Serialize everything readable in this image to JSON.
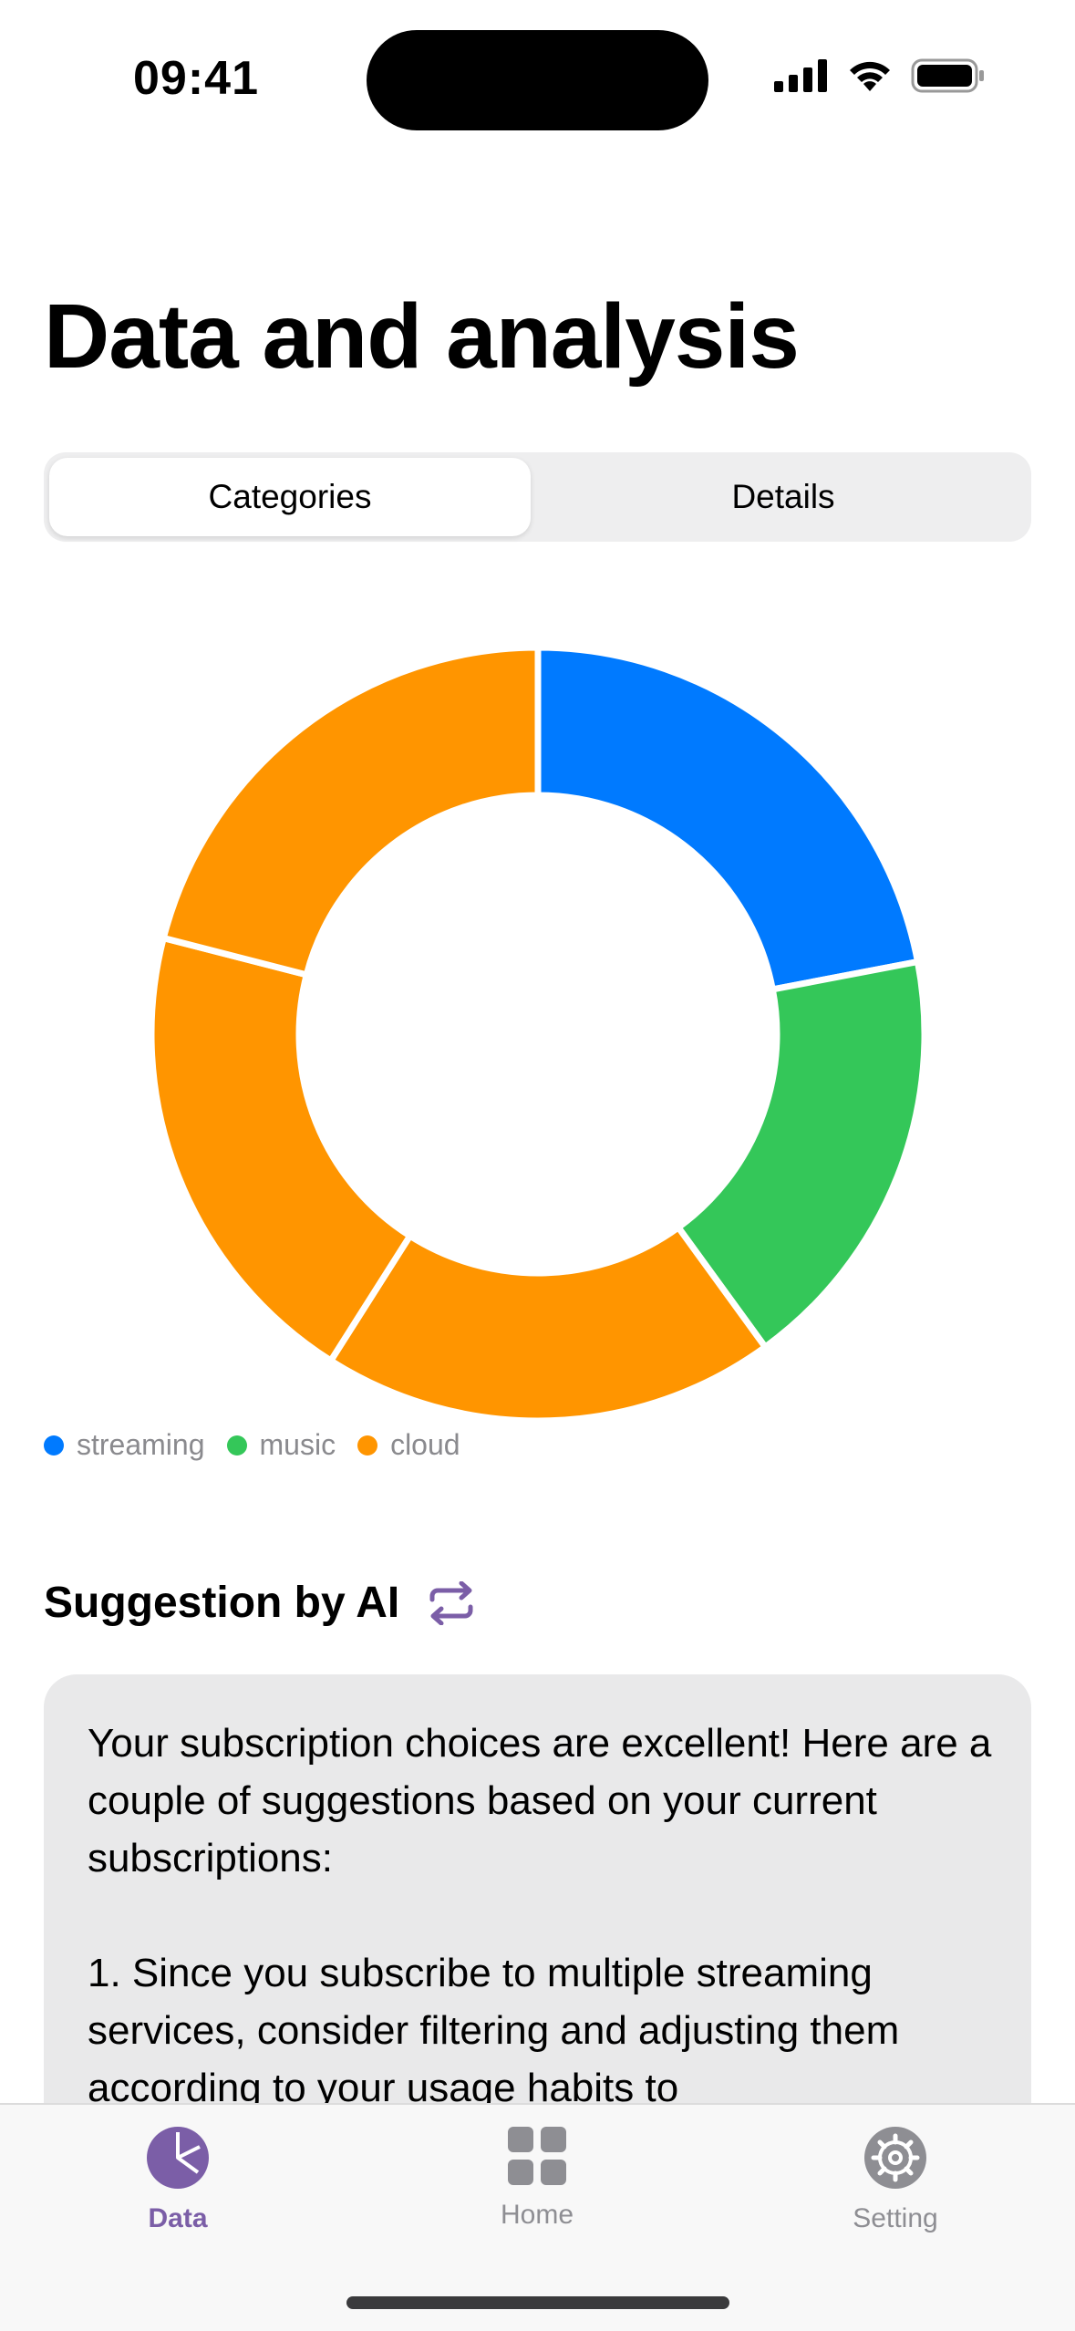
{
  "status_bar": {
    "time": "09:41"
  },
  "header": {
    "title": "Data and analysis"
  },
  "segmented": {
    "tabs": [
      "Categories",
      "Details"
    ],
    "selected": "Categories"
  },
  "chart_data": {
    "type": "pie",
    "variant": "donut",
    "legend": [
      {
        "name": "streaming",
        "color": "#007AFF"
      },
      {
        "name": "music",
        "color": "#34C759"
      },
      {
        "name": "cloud",
        "color": "#FF9500"
      }
    ],
    "slices": [
      {
        "category": "streaming",
        "value": 22,
        "color": "#007AFF"
      },
      {
        "category": "music",
        "value": 18,
        "color": "#34C759"
      },
      {
        "category": "cloud",
        "value": 19,
        "color": "#FF9500"
      },
      {
        "category": "cloud",
        "value": 20,
        "color": "#FF9500"
      },
      {
        "category": "cloud",
        "value": 21,
        "color": "#FF9500"
      }
    ],
    "legend_position": "bottom-left"
  },
  "suggestion": {
    "title": "Suggestion by AI",
    "icon": "repeat-icon",
    "text": "Your subscription choices are excellent! Here are a couple of suggestions based on your current subscriptions:\n\n1. Since you subscribe to multiple streaming services, consider filtering and adjusting them according to your usage habits to"
  },
  "tabbar": {
    "items": [
      {
        "label": "Data",
        "icon": "pie-chart-icon",
        "active": true
      },
      {
        "label": "Home",
        "icon": "grid-icon",
        "active": false
      },
      {
        "label": "Setting",
        "icon": "gear-icon",
        "active": false
      }
    ]
  },
  "colors": {
    "accent": "#7B5EA7",
    "card": "#E9E9EA"
  }
}
